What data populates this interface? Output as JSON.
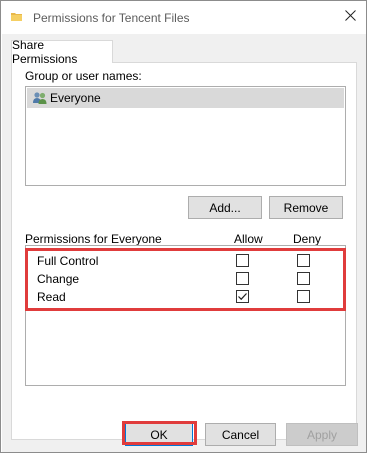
{
  "window": {
    "title": "Permissions for Tencent Files",
    "close_glyph": "✕",
    "icon": "folder-icon"
  },
  "tabs": [
    {
      "label": "Share Permissions",
      "selected": true
    }
  ],
  "group_section": {
    "label": "Group or user names:",
    "users": [
      {
        "name": "Everyone",
        "icon": "user-group-icon",
        "selected": true
      }
    ],
    "add_button": "Add...",
    "remove_button": "Remove"
  },
  "permissions": {
    "header_label": "Permissions for Everyone",
    "allow_header": "Allow",
    "deny_header": "Deny",
    "rows": [
      {
        "name": "Full Control",
        "allow": false,
        "deny": false
      },
      {
        "name": "Change",
        "allow": false,
        "deny": false
      },
      {
        "name": "Read",
        "allow": true,
        "deny": false
      }
    ]
  },
  "footer": {
    "ok_button": "OK",
    "cancel_button": "Cancel",
    "apply_button": "Apply",
    "apply_enabled": false
  },
  "colors": {
    "highlight": "#e03c3c",
    "selection": "#d9d9d9",
    "focus_border": "#0078d7"
  }
}
